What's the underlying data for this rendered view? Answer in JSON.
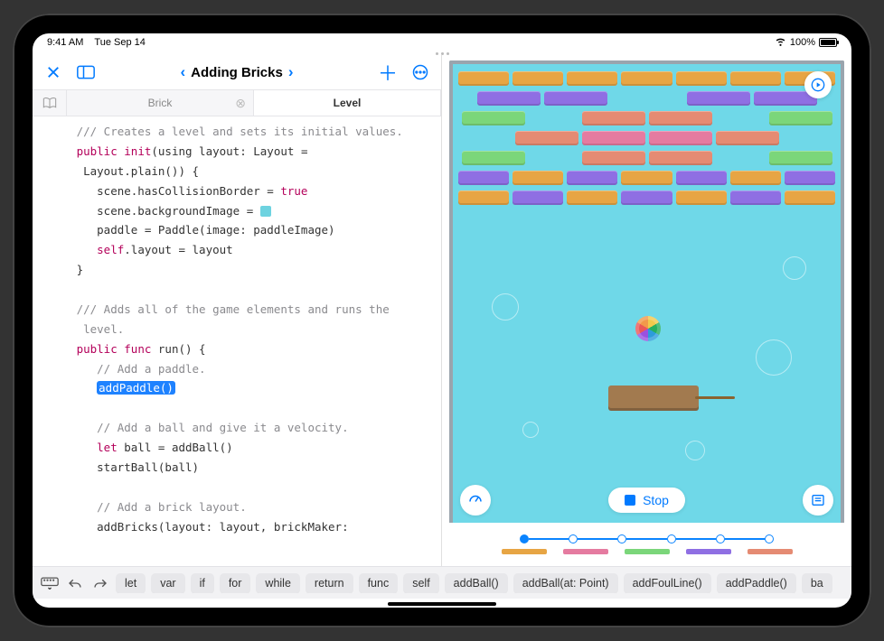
{
  "status": {
    "time": "9:41 AM",
    "date": "Tue Sep 14",
    "battery_text": "100%"
  },
  "toolbar": {
    "title": "Adding Bricks",
    "close_icon": "close",
    "sidebar_icon": "sidebar",
    "back_icon": "chevron-left",
    "fwd_icon": "chevron-right",
    "add_icon": "plus",
    "more_icon": "ellipsis-circle"
  },
  "tabs": {
    "items": [
      {
        "label": "Brick",
        "active": false
      },
      {
        "label": "Level",
        "active": true
      }
    ]
  },
  "code": {
    "lines": [
      {
        "indent": 1,
        "segs": [
          {
            "cls": "c-comment",
            "t": "/// Creates a level and sets its initial values."
          }
        ]
      },
      {
        "indent": 1,
        "segs": [
          {
            "cls": "c-keyword",
            "t": "public"
          },
          {
            "t": " "
          },
          {
            "cls": "c-keyword2",
            "t": "init"
          },
          {
            "t": "(using layout: Layout = "
          }
        ]
      },
      {
        "indent": 1,
        "segs": [
          {
            "t": " Layout.plain()) {"
          }
        ]
      },
      {
        "indent": 2,
        "segs": [
          {
            "t": "scene.hasCollisionBorder = "
          },
          {
            "cls": "c-keyword",
            "t": "true"
          }
        ]
      },
      {
        "indent": 2,
        "segs": [
          {
            "t": "scene.backgroundImage = "
          },
          {
            "swatch": true
          }
        ]
      },
      {
        "indent": 2,
        "segs": [
          {
            "t": "paddle = Paddle(image: paddleImage)"
          }
        ]
      },
      {
        "indent": 2,
        "segs": [
          {
            "cls": "c-keyword",
            "t": "self"
          },
          {
            "t": ".layout = layout"
          }
        ]
      },
      {
        "indent": 1,
        "segs": [
          {
            "t": "}"
          }
        ]
      },
      {
        "indent": 1,
        "segs": [
          {
            "t": ""
          }
        ]
      },
      {
        "indent": 1,
        "segs": [
          {
            "cls": "c-comment",
            "t": "/// Adds all of the game elements and runs the"
          }
        ]
      },
      {
        "indent": 1,
        "segs": [
          {
            "cls": "c-comment",
            "t": " level."
          }
        ]
      },
      {
        "indent": 1,
        "segs": [
          {
            "cls": "c-keyword",
            "t": "public"
          },
          {
            "t": " "
          },
          {
            "cls": "c-keyword",
            "t": "func"
          },
          {
            "t": " run() {"
          }
        ]
      },
      {
        "indent": 2,
        "segs": [
          {
            "cls": "c-comment",
            "t": "// Add a paddle."
          }
        ]
      },
      {
        "indent": 2,
        "segs": [
          {
            "highlight": true,
            "t": "addPaddle()"
          }
        ]
      },
      {
        "indent": 2,
        "segs": [
          {
            "t": ""
          }
        ]
      },
      {
        "indent": 2,
        "segs": [
          {
            "cls": "c-comment",
            "t": "// Add a ball and give it a velocity."
          }
        ]
      },
      {
        "indent": 2,
        "segs": [
          {
            "cls": "c-keyword",
            "t": "let"
          },
          {
            "t": " ball = addBall()"
          }
        ]
      },
      {
        "indent": 2,
        "segs": [
          {
            "t": "startBall(ball)"
          }
        ]
      },
      {
        "indent": 2,
        "segs": [
          {
            "t": ""
          }
        ]
      },
      {
        "indent": 2,
        "segs": [
          {
            "cls": "c-comment",
            "t": "// Add a brick layout."
          }
        ]
      },
      {
        "indent": 2,
        "segs": [
          {
            "t": "addBricks(layout: layout, brickMaker: "
          }
        ]
      }
    ]
  },
  "game": {
    "stop_label": "Stop",
    "colors": {
      "orange": "#e7a544",
      "purple": "#8f6fe3",
      "green": "#7bd67a",
      "salmon": "#e58b73",
      "pink": "#e57ba0"
    },
    "brick_rows": [
      [
        {
          "c": "orange",
          "w": 60
        },
        {
          "c": "orange",
          "w": 60
        },
        {
          "c": "orange",
          "w": 60
        },
        {
          "c": "orange",
          "w": 60
        },
        {
          "c": "orange",
          "w": 60
        },
        {
          "c": "orange",
          "w": 60
        },
        {
          "c": "orange",
          "w": 60
        }
      ],
      [
        {
          "c": "purple",
          "w": 70
        },
        {
          "c": "purple",
          "w": 70
        },
        {
          "gap": 80
        },
        {
          "c": "purple",
          "w": 70
        },
        {
          "c": "purple",
          "w": 70
        }
      ],
      [
        {
          "c": "green",
          "w": 70
        },
        {
          "gap": 55
        },
        {
          "c": "salmon",
          "w": 70
        },
        {
          "c": "salmon",
          "w": 70
        },
        {
          "gap": 55
        },
        {
          "c": "green",
          "w": 70
        }
      ],
      [
        {
          "gap": 35
        },
        {
          "c": "salmon",
          "w": 70
        },
        {
          "c": "pink",
          "w": 70
        },
        {
          "c": "pink",
          "w": 70
        },
        {
          "c": "salmon",
          "w": 70
        },
        {
          "gap": 35
        }
      ],
      [
        {
          "c": "green",
          "w": 70
        },
        {
          "gap": 55
        },
        {
          "c": "salmon",
          "w": 70
        },
        {
          "c": "salmon",
          "w": 70
        },
        {
          "gap": 55
        },
        {
          "c": "green",
          "w": 70
        }
      ],
      [
        {
          "c": "purple",
          "w": 60
        },
        {
          "c": "orange",
          "w": 60
        },
        {
          "c": "purple",
          "w": 60
        },
        {
          "c": "orange",
          "w": 60
        },
        {
          "c": "purple",
          "w": 60
        },
        {
          "c": "orange",
          "w": 60
        },
        {
          "c": "purple",
          "w": 60
        }
      ],
      [
        {
          "c": "orange",
          "w": 60
        },
        {
          "c": "purple",
          "w": 60
        },
        {
          "c": "orange",
          "w": 60
        },
        {
          "c": "purple",
          "w": 60
        },
        {
          "c": "orange",
          "w": 60
        },
        {
          "c": "purple",
          "w": 60
        },
        {
          "c": "orange",
          "w": 60
        }
      ]
    ],
    "timeline_colors": [
      "#e7a544",
      "#e57ba0",
      "#7bd67a",
      "#8f6fe3",
      "#e58b73"
    ]
  },
  "suggestions": {
    "items": [
      "let",
      "var",
      "if",
      "for",
      "while",
      "return",
      "func",
      "self",
      "addBall()",
      "addBall(at: Point)",
      "addFoulLine()",
      "addPaddle()",
      "ba"
    ]
  }
}
